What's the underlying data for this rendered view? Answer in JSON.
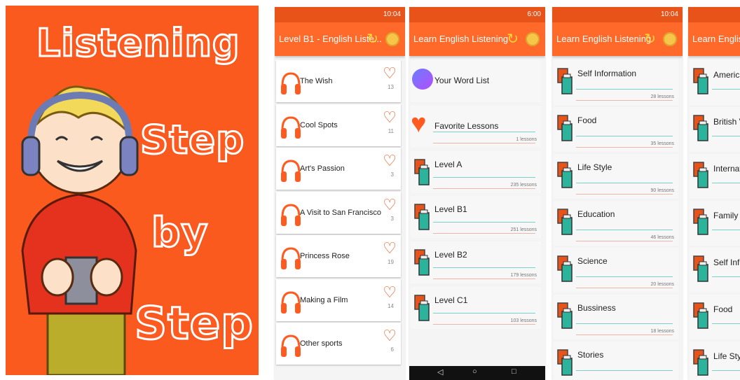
{
  "promo": {
    "words": [
      "Listening",
      "Step",
      "by",
      "Step"
    ]
  },
  "status_times": [
    "10:04",
    "6:00",
    "10:04"
  ],
  "phone1": {
    "title": "Level B1 - English Liste...",
    "lessons": [
      {
        "title": "The Wish",
        "count": "13"
      },
      {
        "title": "Cool Spots",
        "count": "11"
      },
      {
        "title": "Art's Passion",
        "count": "3"
      },
      {
        "title": "A Visit to San Francisco",
        "count": "3"
      },
      {
        "title": "Princess Rose",
        "count": "19"
      },
      {
        "title": "Making a Film",
        "count": "14"
      },
      {
        "title": "Other sports",
        "count": "6"
      }
    ]
  },
  "phone2": {
    "title": "Learn English Listening",
    "items": [
      {
        "title": "Your Word List",
        "count": ""
      },
      {
        "title": "Favorite Lessons",
        "count": "1 lessons"
      },
      {
        "title": "Level A",
        "count": "235 lessons"
      },
      {
        "title": "Level B1",
        "count": "251 lessons"
      },
      {
        "title": "Level B2",
        "count": "179 lessons"
      },
      {
        "title": "Level C1",
        "count": "103 lessons"
      }
    ]
  },
  "phone3": {
    "title": "Learn English Listening",
    "items": [
      {
        "title": "Self Information",
        "count": "28 lessons"
      },
      {
        "title": "Food",
        "count": "35 lessons"
      },
      {
        "title": "Life Style",
        "count": "90 lessons"
      },
      {
        "title": "Education",
        "count": "46 lessons"
      },
      {
        "title": "Science",
        "count": "20 lessons"
      },
      {
        "title": "Bussiness",
        "count": "18 lessons"
      },
      {
        "title": "Stories",
        "count": ""
      }
    ]
  },
  "phone4": {
    "title": "Learn English L",
    "items": [
      {
        "title": "American"
      },
      {
        "title": "British Vo"
      },
      {
        "title": "Internatio"
      },
      {
        "title": "Family"
      },
      {
        "title": "Self Inform"
      },
      {
        "title": "Food"
      },
      {
        "title": "Life Style"
      }
    ]
  },
  "colors": {
    "accent": "#ff6a2a",
    "status": "#e8531a",
    "teal": "#2bb39b"
  },
  "icons": [
    "headphones-icon",
    "heart-icon",
    "refresh-icon",
    "palette-icon",
    "book-icon",
    "list-icon"
  ]
}
